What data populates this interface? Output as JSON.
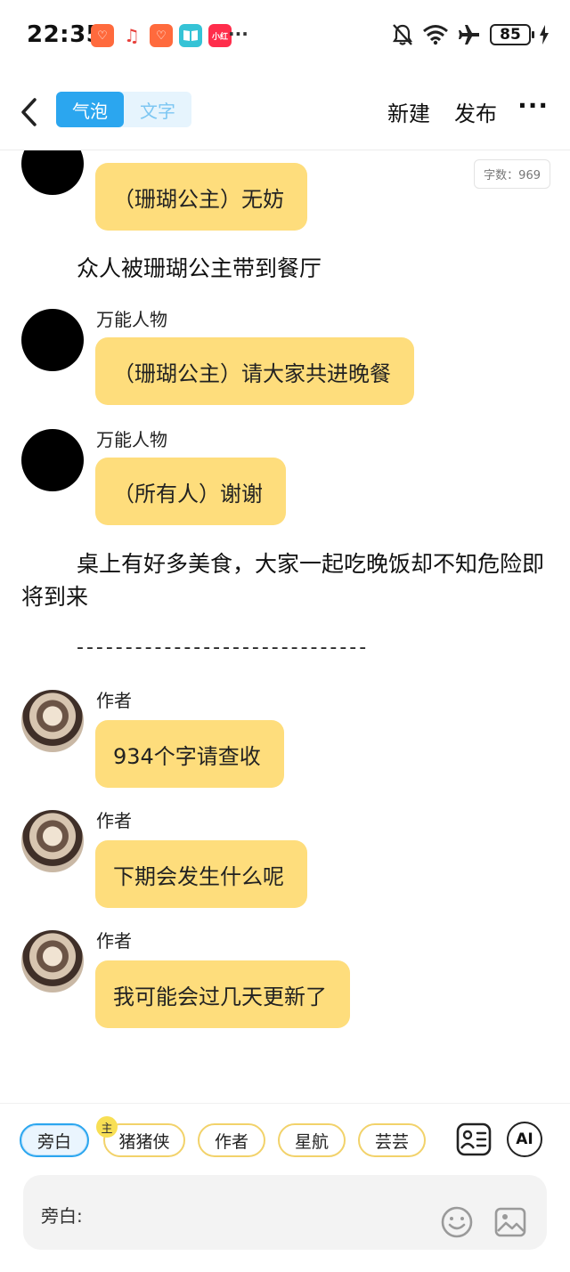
{
  "status_bar": {
    "time": "22:35",
    "app_icons": [
      {
        "name": "taobao-heart-icon",
        "color": "#ff6a3d",
        "glyph": "♡"
      },
      {
        "name": "music-icon",
        "color": "#ffffff",
        "glyph": "♫"
      },
      {
        "name": "taobao-heart-icon-2",
        "color": "#ff6a3d",
        "glyph": "♡"
      },
      {
        "name": "reading-app-icon",
        "color": "#35c3d6",
        "glyph": "📖"
      },
      {
        "name": "xiaohongshu-icon",
        "color": "#ff2d4b",
        "glyph": "小"
      }
    ],
    "overflow": "···",
    "battery": "85"
  },
  "header": {
    "tab_bubble": "气泡",
    "tab_text": "文字",
    "new_label": "新建",
    "publish_label": "发布",
    "more_label": "···"
  },
  "chat": {
    "word_count": "字数：969",
    "items": [
      {
        "sender": "",
        "text": "（珊瑚公主）无妨"
      },
      {
        "narration": "众人被珊瑚公主带到餐厅"
      },
      {
        "sender": "万能人物",
        "text": "（珊瑚公主）请大家共进晚餐"
      },
      {
        "sender": "万能人物",
        "text": "（所有人）谢谢"
      },
      {
        "narration": "桌上有好多美食，大家一起吃晚饭却不知危险即将到来"
      },
      {
        "separator": "------------------------------"
      },
      {
        "sender": "作者",
        "text": "934个字请查收"
      },
      {
        "sender": "作者",
        "text": "下期会发生什么呢"
      },
      {
        "sender": "作者",
        "text": "我可能会过几天更新了"
      }
    ]
  },
  "bottom": {
    "chips": [
      "旁白",
      "猪猪侠",
      "作者",
      "星航",
      "芸芸"
    ],
    "main_badge": "主",
    "ai_label": "AI",
    "input_label": "旁白:"
  },
  "colors": {
    "accent": "#2ba6ef",
    "bubble": "#fedd7c",
    "chip_border": "#f2d26a"
  }
}
